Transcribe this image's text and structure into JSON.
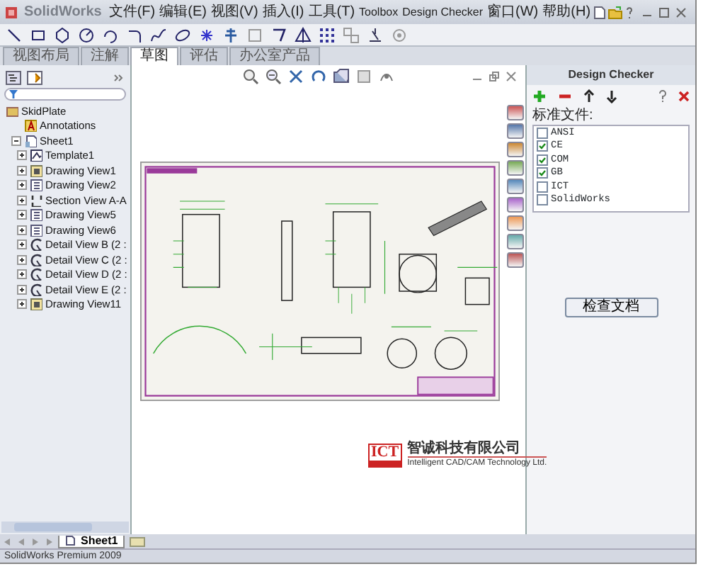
{
  "app": {
    "logo": "SolidWorks",
    "menu": [
      "文件(F)",
      "编辑(E)",
      "视图(V)",
      "插入(I)",
      "工具(T)",
      "Toolbox",
      "Design Checker",
      "窗口(W)",
      "帮助(H)"
    ]
  },
  "command_tabs": [
    {
      "label": "视图布局",
      "selected": false
    },
    {
      "label": "注解",
      "selected": false
    },
    {
      "label": "草图",
      "selected": true
    },
    {
      "label": "评估",
      "selected": false
    },
    {
      "label": "办公室产品",
      "selected": false
    }
  ],
  "feature_tree": {
    "root": {
      "label": "SkidPlate",
      "kind": "part",
      "children": [
        {
          "label": "Annotations",
          "kind": "annotations"
        },
        {
          "label": "Sheet1",
          "kind": "sheet",
          "expanded": true,
          "children": [
            {
              "label": "Template1",
              "kind": "template",
              "expanded": false
            },
            {
              "label": "Drawing View1",
              "kind": "view3d",
              "expanded": false
            },
            {
              "label": "Drawing View2",
              "kind": "view",
              "expanded": false
            },
            {
              "label": "Section View A-A",
              "kind": "section",
              "expanded": false
            },
            {
              "label": "Drawing View5",
              "kind": "view",
              "expanded": false
            },
            {
              "label": "Drawing View6",
              "kind": "view",
              "expanded": false
            },
            {
              "label": "Detail View B (2 :",
              "kind": "detail",
              "expanded": false
            },
            {
              "label": "Detail View C (2 :",
              "kind": "detail",
              "expanded": false
            },
            {
              "label": "Detail View D (2 :",
              "kind": "detail",
              "expanded": false
            },
            {
              "label": "Detail View E (2 :",
              "kind": "detail",
              "expanded": false
            },
            {
              "label": "Drawing View11",
              "kind": "view3d",
              "expanded": false
            }
          ]
        }
      ]
    }
  },
  "company_logo": {
    "mark": "ICT",
    "name": "智诚科技有限公司",
    "tagline": "Intelligent CAD/CAM Technology Ltd."
  },
  "design_checker": {
    "title": "Design Checker",
    "section_label": "标准文件:",
    "standards": [
      {
        "label": "ANSI",
        "checked": false
      },
      {
        "label": "CE",
        "checked": true
      },
      {
        "label": "COM",
        "checked": true
      },
      {
        "label": "GB",
        "checked": true
      },
      {
        "label": "ICT",
        "checked": false
      },
      {
        "label": "SolidWorks",
        "checked": false
      }
    ],
    "button": "检查文档"
  },
  "sheet_tabs": [
    {
      "label": "Sheet1",
      "selected": true
    }
  ],
  "status_bar": {
    "text": "SolidWorks Premium 2009"
  }
}
